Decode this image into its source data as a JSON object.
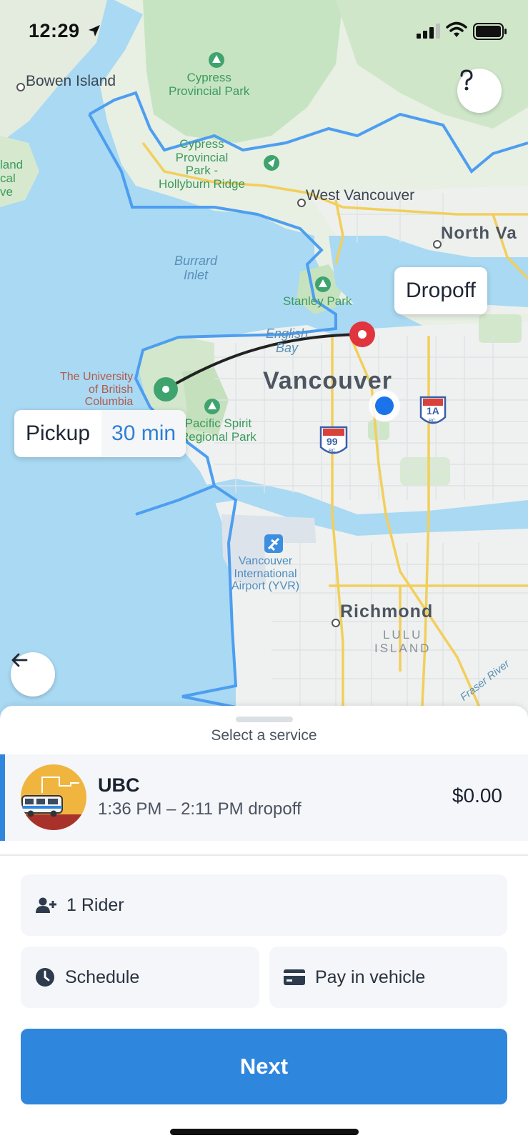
{
  "status_bar": {
    "time": "12:29"
  },
  "map": {
    "labels": {
      "bowen_island": "Bowen Island",
      "island_partial_1": "land",
      "island_partial_2": "cal",
      "island_partial_3": "ve",
      "cypress_park_1": "Cypress\nProvincial Park",
      "cypress_park_2": "Cypress\nProvincial\nPark -\nHollyburn Ridge",
      "west_vancouver": "West Vancouver",
      "north_vancouver": "North Va",
      "burrard_inlet": "Burrard\nInlet",
      "stanley_park": "Stanley Park",
      "english_bay": "English\nBay",
      "ubc": "The University\nof British\nColumbia",
      "pacific_spirit": "Pacific Spirit\nRegional Park",
      "vancouver": "Vancouver",
      "airport": "Vancouver\nInternational\nAirport (YVR)",
      "richmond": "Richmond",
      "lulu_island": "LULU\nISLAND",
      "fraser_river": "Fraser River",
      "highway_99": "99",
      "highway_1a": "1A",
      "shield_sub": "BC"
    },
    "dropoff_label": "Dropoff",
    "pickup_label": "Pickup",
    "pickup_eta": "30 min"
  },
  "sheet": {
    "title": "Select a service",
    "service": {
      "name": "UBC",
      "time": "1:36 PM – 2:11 PM dropoff",
      "price": "$0.00"
    },
    "riders": "1 Rider",
    "schedule": "Schedule",
    "payment": "Pay in vehicle",
    "next": "Next"
  },
  "colors": {
    "accent": "#2f86dd",
    "dropoff_pin": "#e0343f",
    "pickup_pin": "#3fa36e",
    "zone_boundary": "#4d9ef0",
    "user_location": "#1a73e8"
  },
  "icons": [
    "location-arrow-icon",
    "signal-icon",
    "wifi-icon",
    "battery-icon",
    "help-icon",
    "back-arrow-icon",
    "add-user-icon",
    "clock-icon",
    "credit-card-icon"
  ]
}
